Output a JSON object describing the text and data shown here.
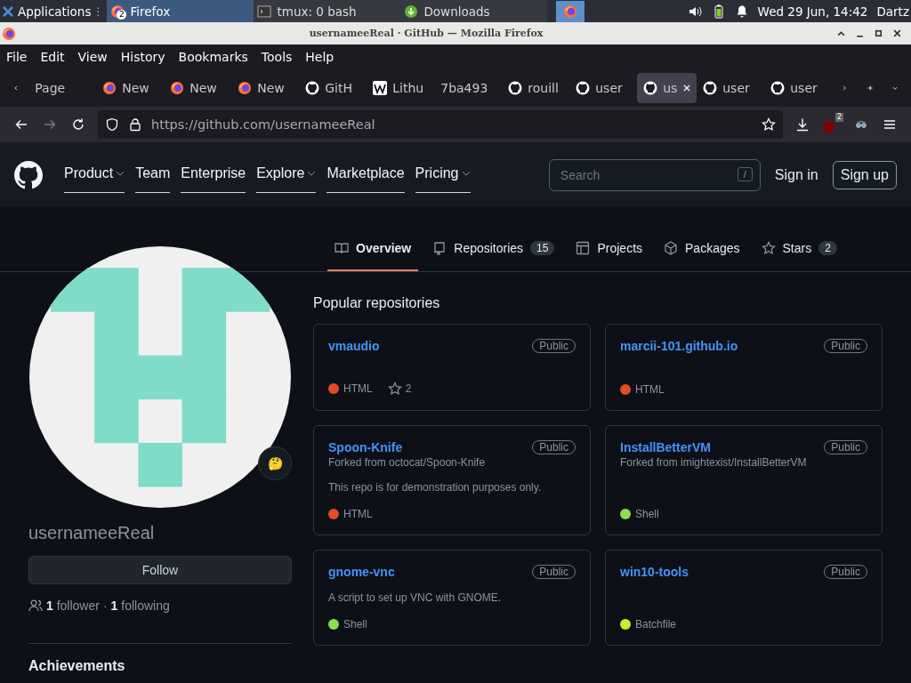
{
  "taskbar": {
    "apps_menu": "Applications",
    "tasks": [
      {
        "label": "Firefox",
        "kind": "firefox",
        "badge": "2",
        "selected": true
      },
      {
        "label": "tmux: 0 bash",
        "kind": "terminal",
        "selected": false
      },
      {
        "label": "Downloads",
        "kind": "download",
        "selected": false
      }
    ],
    "separator": "⋮",
    "clock": "Wed 29 Jun, 14:42",
    "user": "Dartz"
  },
  "window": {
    "title": "usernameeReal · GitHub — Mozilla Firefox"
  },
  "menu": [
    "File",
    "Edit",
    "View",
    "History",
    "Bookmarks",
    "Tools",
    "Help"
  ],
  "tabs": [
    {
      "label": "Page",
      "kind": "plain",
      "selected": false
    },
    {
      "label": "New",
      "kind": "firefox",
      "selected": false
    },
    {
      "label": "New",
      "kind": "firefox",
      "selected": false
    },
    {
      "label": "New",
      "kind": "firefox",
      "selected": false
    },
    {
      "label": "GitH",
      "kind": "github",
      "selected": false
    },
    {
      "label": "Lithu",
      "kind": "wiki",
      "selected": false
    },
    {
      "label": "7ba493",
      "kind": "plain",
      "selected": false
    },
    {
      "label": "rouill",
      "kind": "github",
      "selected": false
    },
    {
      "label": "user",
      "kind": "github",
      "selected": false
    },
    {
      "label": "us",
      "kind": "github",
      "selected": true
    },
    {
      "label": "user",
      "kind": "github",
      "selected": false
    },
    {
      "label": "user",
      "kind": "github",
      "selected": false
    }
  ],
  "url": {
    "host": "https://github.com",
    "path": "/usernameeReal"
  },
  "extension_badge": "2",
  "gh_nav": [
    {
      "label": "Product",
      "dropdown": true
    },
    {
      "label": "Team",
      "dropdown": false
    },
    {
      "label": "Enterprise",
      "dropdown": false
    },
    {
      "label": "Explore",
      "dropdown": true
    },
    {
      "label": "Marketplace",
      "dropdown": false
    },
    {
      "label": "Pricing",
      "dropdown": true
    }
  ],
  "search": {
    "placeholder": "Search",
    "shortcut": "/"
  },
  "sign_in": "Sign in",
  "sign_up": "Sign up",
  "profile_tabs": [
    {
      "label": "Overview",
      "kind": "book",
      "selected": true
    },
    {
      "label": "Repositories",
      "kind": "repo",
      "count": "15",
      "selected": false
    },
    {
      "label": "Projects",
      "kind": "table",
      "selected": false
    },
    {
      "label": "Packages",
      "kind": "package",
      "selected": false
    },
    {
      "label": "Stars",
      "kind": "star",
      "count": "2",
      "selected": false
    }
  ],
  "profile": {
    "status_emoji": "🤔",
    "username": "usernameeReal",
    "follow": "Follow",
    "followers": "1",
    "followers_label": "follower",
    "separator": "·",
    "following": "1",
    "following_label": "following",
    "achievements": "Achievements"
  },
  "popular_title": "Popular repositories",
  "repos": [
    {
      "name": "vmaudio",
      "visibility": "Public",
      "language": "HTML",
      "color": "#e34c26",
      "stars": "2"
    },
    {
      "name": "marcii-101.github.io",
      "visibility": "Public",
      "language": "HTML",
      "color": "#e34c26"
    },
    {
      "name": "Spoon-Knife",
      "visibility": "Public",
      "fork": "Forked from octocat/Spoon-Knife",
      "description": "This repo is for demonstration purposes only.",
      "language": "HTML",
      "color": "#e34c26"
    },
    {
      "name": "InstallBetterVM",
      "visibility": "Public",
      "fork": "Forked from imightexist/InstallBetterVM",
      "language": "Shell",
      "color": "#89e051"
    },
    {
      "name": "gnome-vnc",
      "visibility": "Public",
      "description": "A script to set up VNC with GNOME.",
      "language": "Shell",
      "color": "#89e051"
    },
    {
      "name": "win10-tools",
      "visibility": "Public",
      "language": "Batchfile",
      "color": "#c1f12e"
    }
  ]
}
